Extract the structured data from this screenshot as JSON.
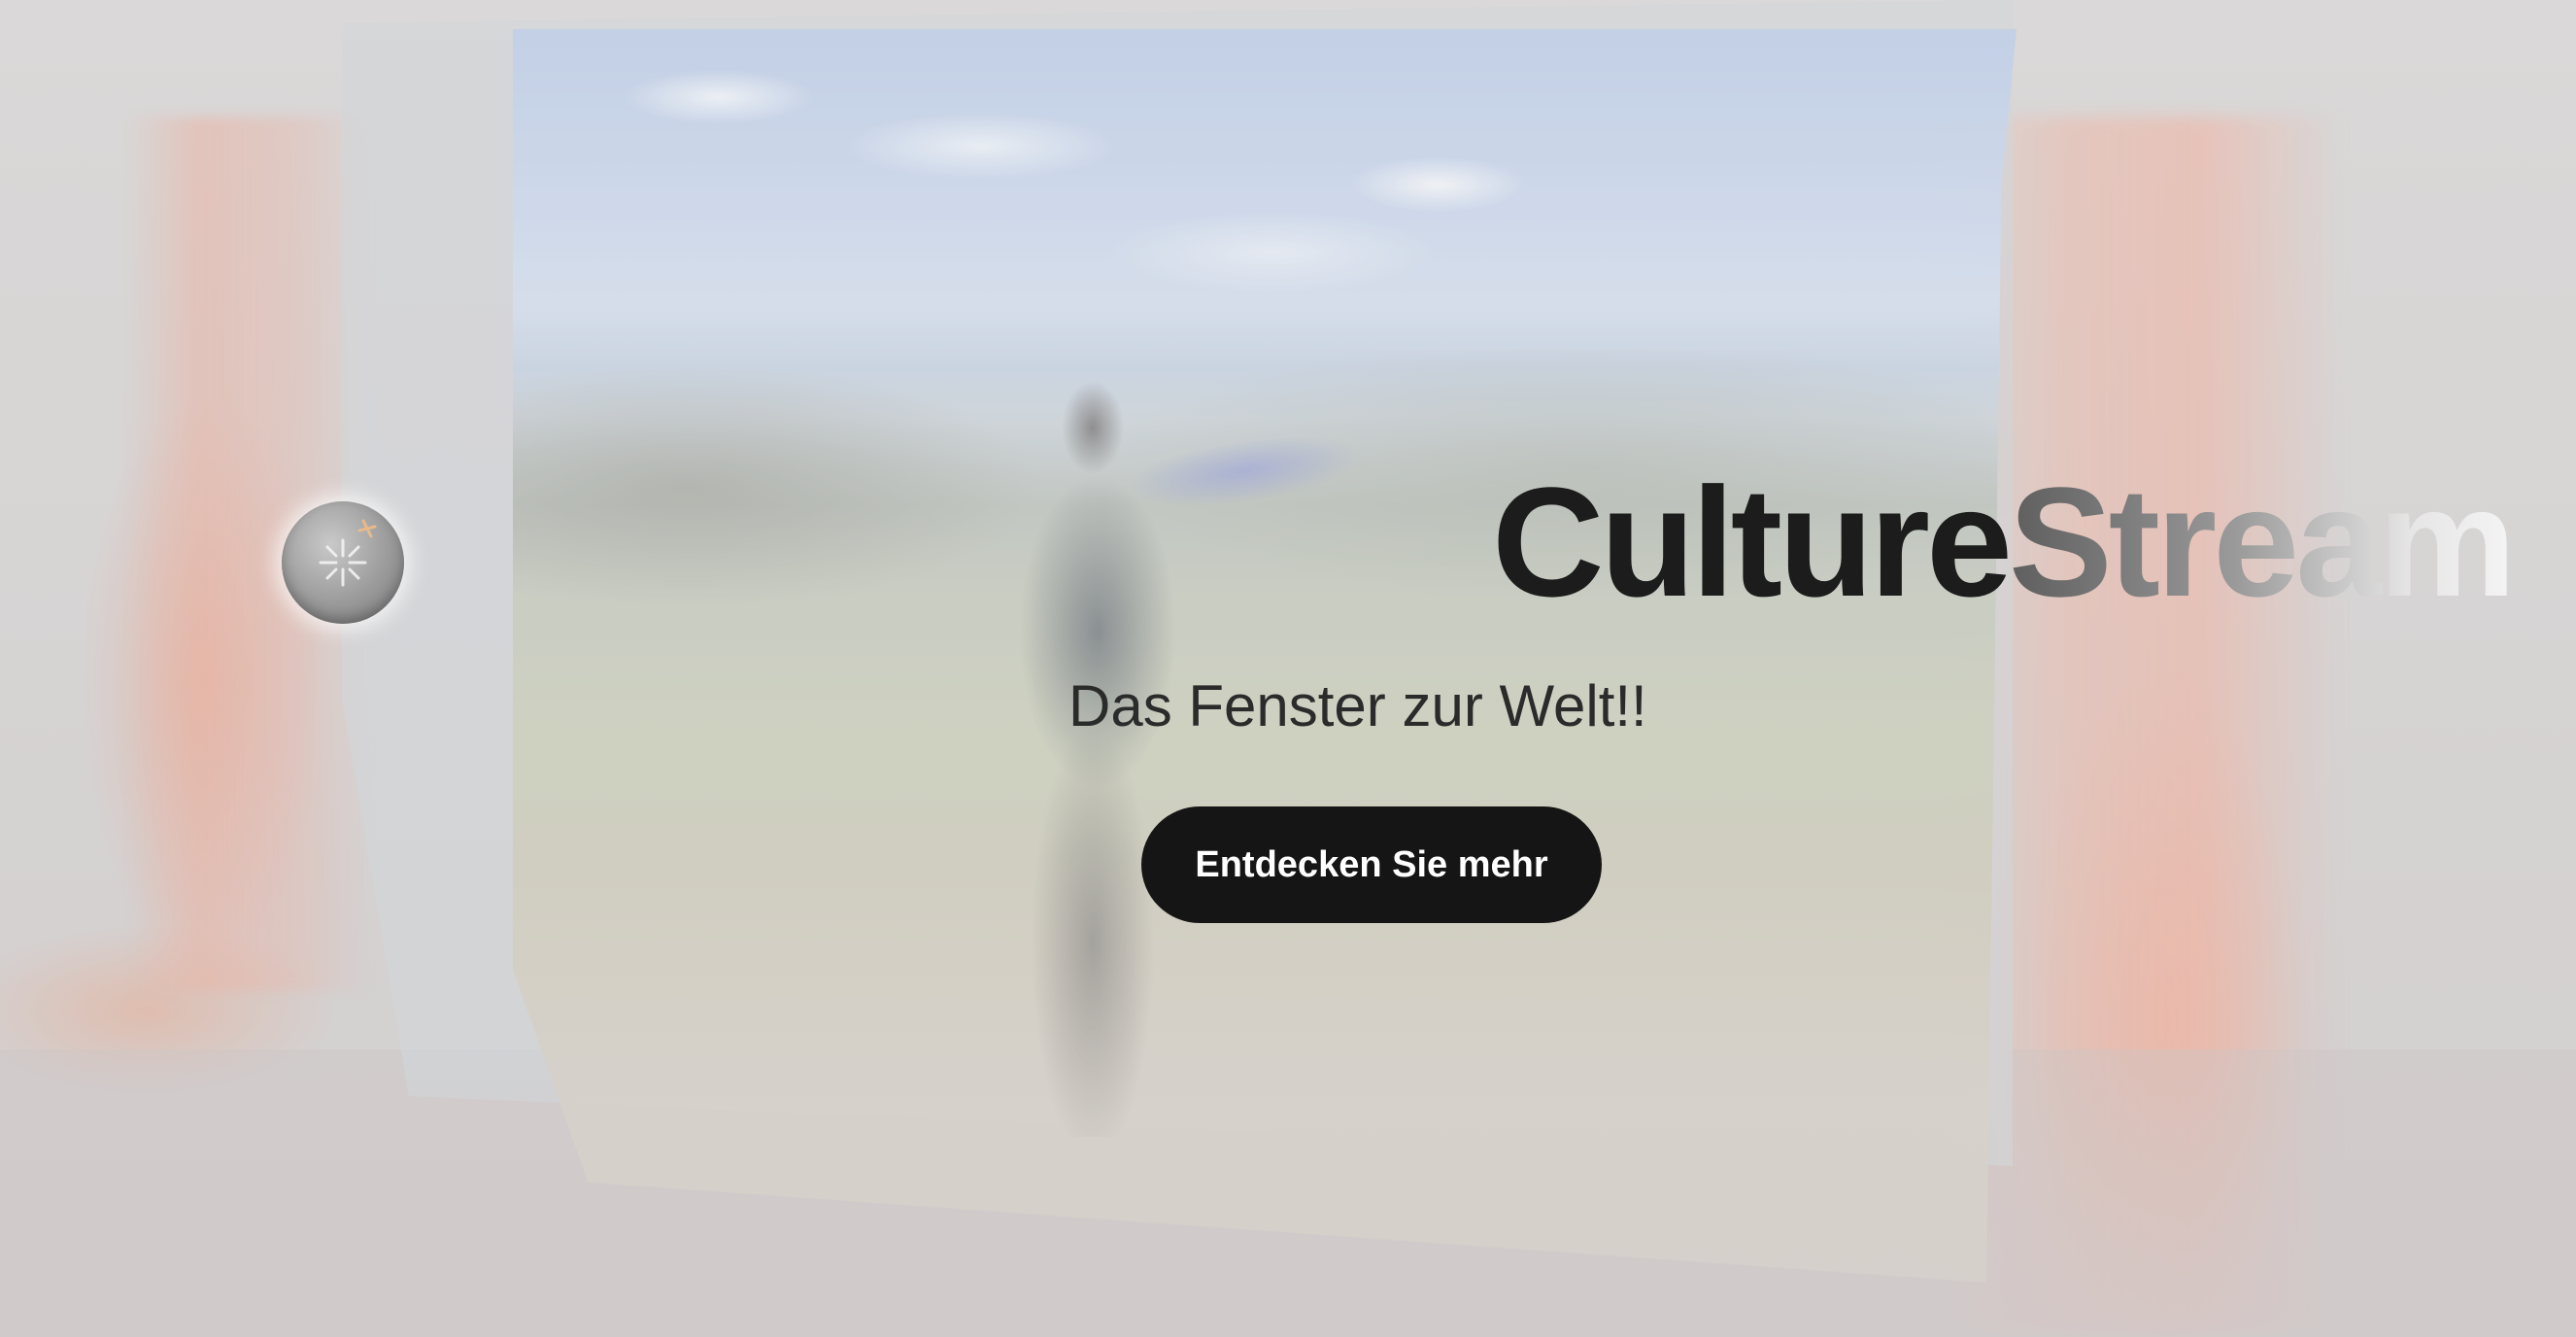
{
  "brand": {
    "part1": "Culture",
    "part2": "Stream"
  },
  "hero": {
    "tagline": "Das Fenster zur Welt!!",
    "cta_label": "Entdecken Sie mehr"
  },
  "icons": {
    "orb": "sparkle-orb-icon"
  },
  "colors": {
    "cta_background": "#151515",
    "cta_text": "#ffffff",
    "brand_dark": "#1c1c1c",
    "tagline": "#2b2b2b"
  }
}
